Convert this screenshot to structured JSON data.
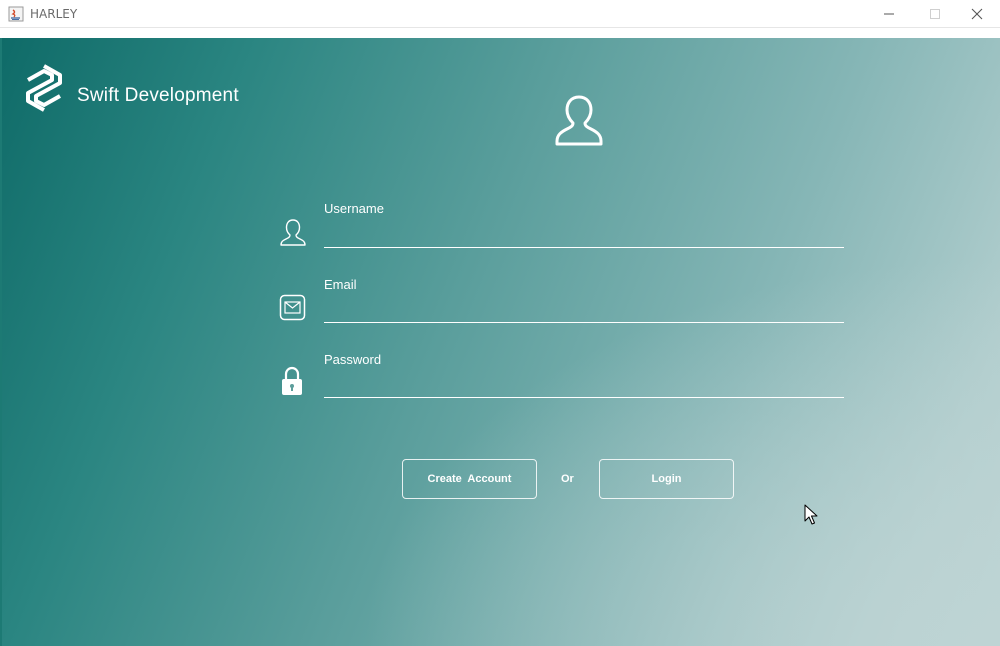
{
  "window": {
    "title": "HARLEY",
    "controls": {
      "minimize_icon": "minimize-icon",
      "maximize_icon": "maximize-icon",
      "close_icon": "close-icon"
    }
  },
  "brand": {
    "name": "Swift Development",
    "logo_icon": "s-logo-icon"
  },
  "form": {
    "avatar_icon": "user-outline-icon",
    "fields": [
      {
        "label": "Username",
        "icon": "user-icon",
        "value": ""
      },
      {
        "label": "Email",
        "icon": "envelope-icon",
        "value": ""
      },
      {
        "label": "Password",
        "icon": "lock-icon",
        "value": ""
      }
    ]
  },
  "actions": {
    "create_account": "Create  Account",
    "or": "Or",
    "login": "Login"
  },
  "colors": {
    "accent": "#1d7a74",
    "gradient_start": "#0f6b68",
    "gradient_end": "#bcd4d4",
    "text": "#ffffff"
  }
}
